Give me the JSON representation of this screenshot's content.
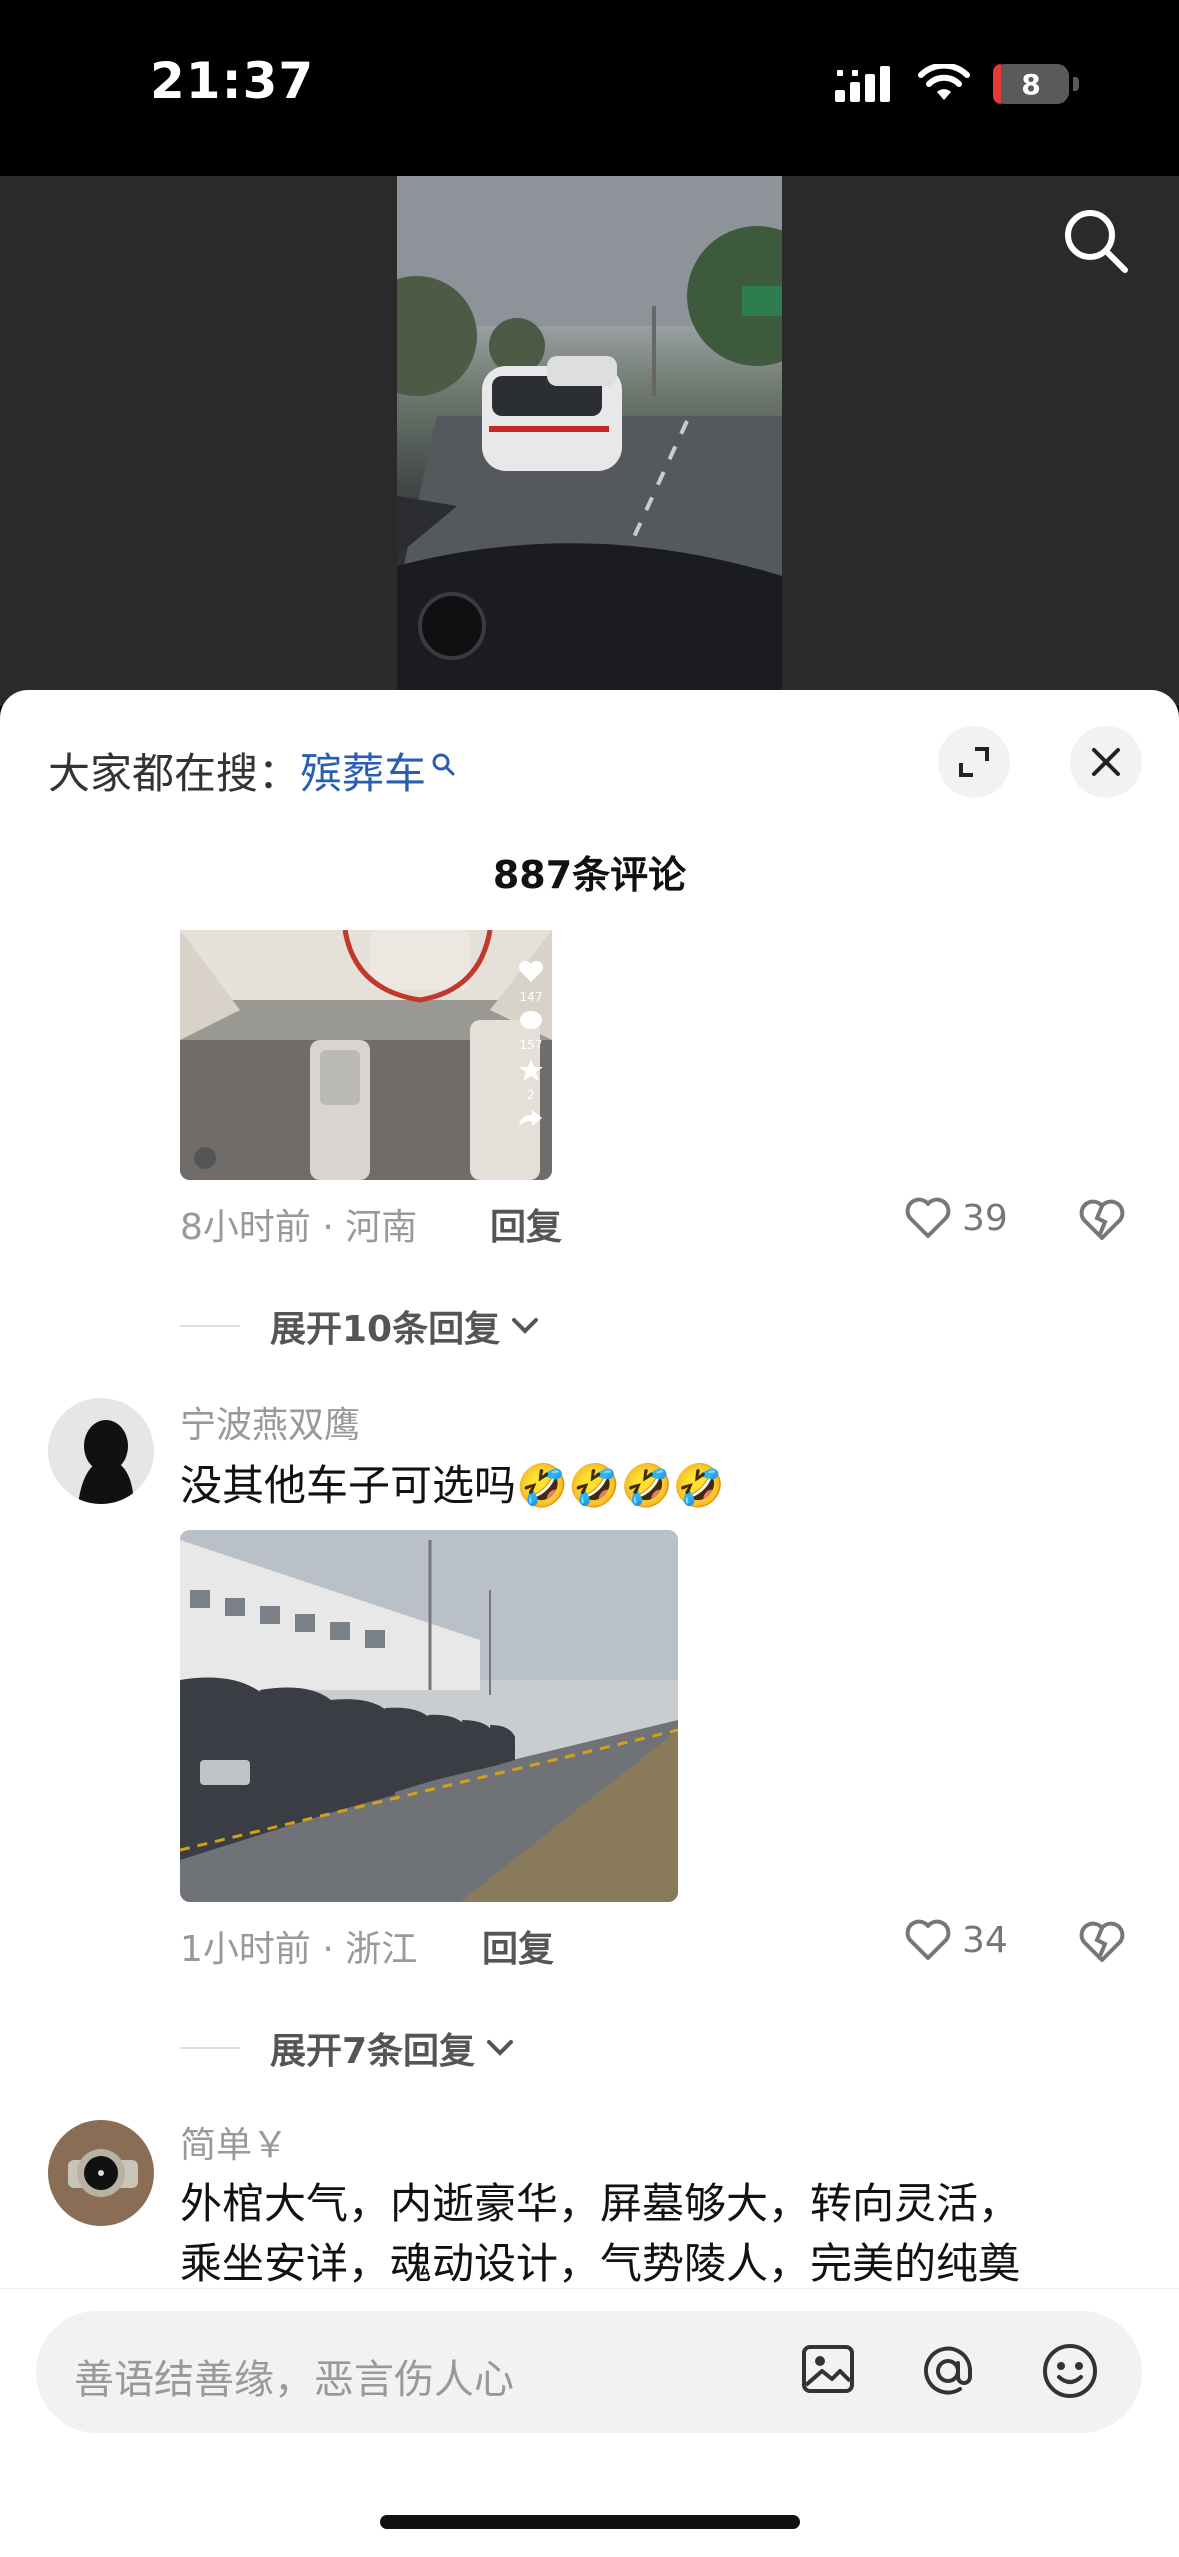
{
  "status_bar": {
    "time": "21:37",
    "battery_level": "8"
  },
  "hot_search": {
    "prefix": "大家都在搜：",
    "term": "殡葬车"
  },
  "comments_header": {
    "count_label": "887条评论"
  },
  "comments": [
    {
      "meta": "8小时前 · 河南",
      "reply_label": "回复",
      "likes": "39",
      "expand_label": "展开10条回复",
      "image_overlay": {
        "likes": "147",
        "comments": "157",
        "favorites": "2"
      }
    },
    {
      "username": "宁波燕双鹰",
      "text": "没其他车子可选吗🤣🤣🤣🤣",
      "meta": "1小时前 · 浙江",
      "reply_label": "回复",
      "likes": "34",
      "expand_label": "展开7条回复"
    },
    {
      "username": "简单￥",
      "text_line1": "外棺大气，内逝豪华，屏墓够大，转向灵活，",
      "text_line2": "乘坐安详，魂动设计，气势陵人，完美的纯奠"
    }
  ],
  "input": {
    "placeholder": "善语结善缘，恶言伤人心"
  },
  "colors": {
    "accent_link": "#2a5fb0",
    "battery_low": "#e53935"
  }
}
